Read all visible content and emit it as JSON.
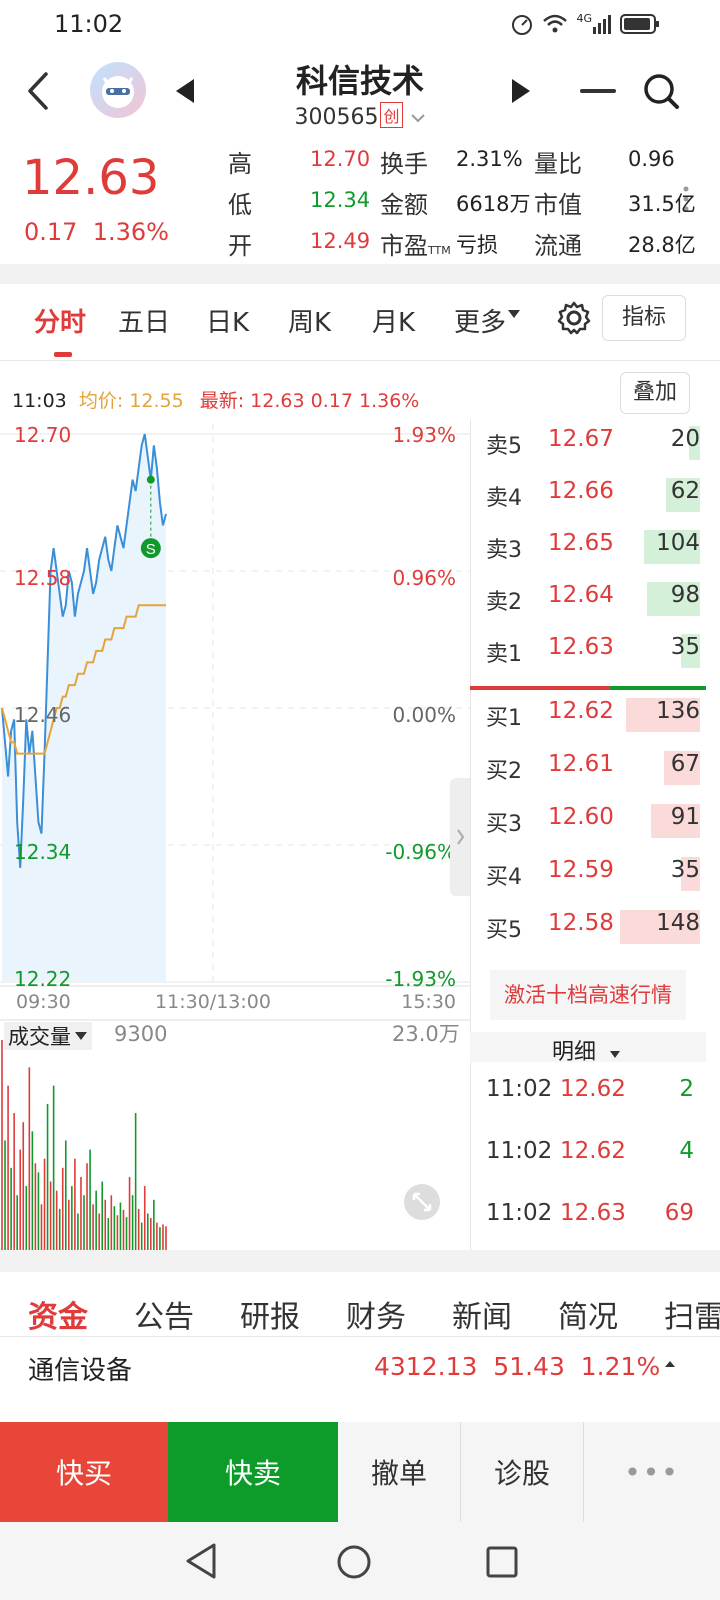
{
  "status_bar": {
    "time": "11:02",
    "network": "4G"
  },
  "header": {
    "back_icon": "chevron-left-icon",
    "title": "科信技术",
    "code": "300565",
    "board_tag": "创",
    "prev_icon": "triangle-left-icon",
    "next_icon": "triangle-right-icon",
    "menu_icon": "minus-icon",
    "search_icon": "search-icon"
  },
  "quote": {
    "price": "12.63",
    "change": "0.17",
    "change_pct": "1.36%",
    "rows": [
      [
        {
          "label": "高",
          "value": "12.70",
          "color": "#e03b3b"
        },
        {
          "label": "换手",
          "value": "2.31%",
          "color": "#222"
        },
        {
          "label": "量比",
          "value": "0.96",
          "color": "#222"
        }
      ],
      [
        {
          "label": "低",
          "value": "12.34",
          "color": "#119a2c"
        },
        {
          "label": "金额",
          "value": "6618万",
          "color": "#222"
        },
        {
          "label": "市值",
          "value": "31.5亿",
          "color": "#222"
        }
      ],
      [
        {
          "label": "开",
          "value": "12.49",
          "color": "#e03b3b"
        },
        {
          "label": "市盈TTM",
          "value": "亏损",
          "color": "#222"
        },
        {
          "label": "流通",
          "value": "28.8亿",
          "color": "#222"
        }
      ]
    ]
  },
  "tabs": {
    "items": [
      "分时",
      "五日",
      "日K",
      "周K",
      "月K",
      "更多"
    ],
    "active": "分时",
    "settings_icon": "gear-icon",
    "indicator_button": "指标"
  },
  "info_bar": {
    "time": "11:03",
    "avg_label": "均价:",
    "avg_value": "12.55",
    "latest_label": "最新:",
    "latest_value": "12.63",
    "latest_change": "0.17",
    "latest_pct": "1.36%",
    "overlay_button": "叠加"
  },
  "chart_data": {
    "type": "line",
    "title": "",
    "y_labels_left": [
      "12.70",
      "12.58",
      "12.46",
      "12.34",
      "12.22"
    ],
    "y_labels_right": [
      "1.93%",
      "0.96%",
      "0.00%",
      "-0.96%",
      "-1.93%"
    ],
    "ylim": [
      12.22,
      12.7
    ],
    "prev_close": 12.46,
    "x_labels": [
      "09:30",
      "11:30/13:00",
      "15:30"
    ],
    "series": [
      {
        "key": "price",
        "color": "#3a8fd8",
        "values": [
          12.46,
          12.43,
          12.4,
          12.44,
          12.45,
          12.36,
          12.32,
          12.38,
          12.45,
          12.42,
          12.44,
          12.4,
          12.36,
          12.35,
          12.42,
          12.5,
          12.58,
          12.6,
          12.58,
          12.56,
          12.54,
          12.55,
          12.58,
          12.57,
          12.54,
          12.56,
          12.57,
          12.58,
          12.6,
          12.58,
          12.56,
          12.57,
          12.59,
          12.6,
          12.61,
          12.59,
          12.58,
          12.6,
          12.62,
          12.61,
          12.6,
          12.62,
          12.64,
          12.66,
          12.65,
          12.67,
          12.69,
          12.7,
          12.68,
          12.66,
          12.69,
          12.67,
          12.64,
          12.62,
          12.63
        ]
      },
      {
        "key": "avg",
        "color": "#e6a23c",
        "values": [
          12.46,
          12.45,
          12.44,
          12.43,
          12.43,
          12.42,
          12.42,
          12.42,
          12.42,
          12.42,
          12.42,
          12.42,
          12.42,
          12.42,
          12.42,
          12.43,
          12.44,
          12.45,
          12.46,
          12.46,
          12.47,
          12.47,
          12.48,
          12.48,
          12.48,
          12.49,
          12.49,
          12.49,
          12.5,
          12.5,
          12.5,
          12.51,
          12.51,
          12.51,
          12.52,
          12.52,
          12.52,
          12.53,
          12.53,
          12.53,
          12.53,
          12.54,
          12.54,
          12.54,
          12.54,
          12.55,
          12.55,
          12.55,
          12.55,
          12.55,
          12.55,
          12.55,
          12.55,
          12.55,
          12.55
        ]
      }
    ],
    "markers": [
      {
        "label": "S",
        "value": 12.6
      }
    ],
    "volume": {
      "label": "成交量",
      "current": "9300",
      "max_label": "23.0万",
      "max": 230000,
      "bars": [
        230000,
        120000,
        180000,
        90000,
        150000,
        60000,
        110000,
        140000,
        70000,
        200000,
        130000,
        95000,
        85000,
        50000,
        100000,
        160000,
        75000,
        180000,
        65000,
        45000,
        90000,
        120000,
        55000,
        70000,
        100000,
        40000,
        80000,
        60000,
        95000,
        110000,
        50000,
        65000,
        40000,
        75000,
        55000,
        35000,
        60000,
        48000,
        38000,
        52000,
        44000,
        36000,
        80000,
        60000,
        150000,
        45000,
        30000,
        70000,
        40000,
        35000,
        55000,
        30000,
        25000,
        28000,
        26000
      ],
      "colors": [
        "r",
        "g",
        "r",
        "g",
        "r",
        "g",
        "r",
        "r",
        "g",
        "r",
        "g",
        "r",
        "g",
        "r",
        "r",
        "g",
        "r",
        "g",
        "r",
        "g",
        "r",
        "g",
        "r",
        "g",
        "r",
        "g",
        "r",
        "g",
        "r",
        "g",
        "r",
        "g",
        "r",
        "g",
        "r",
        "g",
        "r",
        "g",
        "r",
        "g",
        "r",
        "g",
        "r",
        "g",
        "g",
        "r",
        "g",
        "r",
        "g",
        "r",
        "g",
        "r",
        "g",
        "r",
        "r"
      ]
    }
  },
  "order_book": {
    "asks": [
      {
        "label": "卖5",
        "price": "12.67",
        "vol": "20",
        "bar": 0.14
      },
      {
        "label": "卖4",
        "price": "12.66",
        "vol": "62",
        "bar": 0.42
      },
      {
        "label": "卖3",
        "price": "12.65",
        "vol": "104",
        "bar": 0.7
      },
      {
        "label": "卖2",
        "price": "12.64",
        "vol": "98",
        "bar": 0.66
      },
      {
        "label": "卖1",
        "price": "12.63",
        "vol": "35",
        "bar": 0.24
      }
    ],
    "bids": [
      {
        "label": "买1",
        "price": "12.62",
        "vol": "136",
        "bar": 0.92
      },
      {
        "label": "买2",
        "price": "12.61",
        "vol": "67",
        "bar": 0.45
      },
      {
        "label": "买3",
        "price": "12.60",
        "vol": "91",
        "bar": 0.61
      },
      {
        "label": "买4",
        "price": "12.59",
        "vol": "35",
        "bar": 0.24
      },
      {
        "label": "买5",
        "price": "12.58",
        "vol": "148",
        "bar": 1.0
      }
    ],
    "activate_button": "激活十档高速行情"
  },
  "ticks": {
    "header": "明细",
    "rows": [
      {
        "time": "11:02",
        "price": "12.62",
        "vol": "2",
        "vol_color": "#119a2c"
      },
      {
        "time": "11:02",
        "price": "12.62",
        "vol": "4",
        "vol_color": "#119a2c"
      },
      {
        "time": "11:02",
        "price": "12.63",
        "vol": "69",
        "vol_color": "#e03b3b"
      }
    ]
  },
  "bottom_tabs": {
    "items": [
      "资金",
      "公告",
      "研报",
      "财务",
      "新闻",
      "简况",
      "扫雷"
    ],
    "active": "资金"
  },
  "sector": {
    "name": "通信设备",
    "value": "4312.13",
    "change": "51.43",
    "pct": "1.21%"
  },
  "actions": {
    "buy": "快买",
    "sell": "快卖",
    "cancel": "撤单",
    "diagnose": "诊股",
    "more": "•••"
  },
  "colors": {
    "up": "#e03b3b",
    "down": "#119a2c",
    "price_line": "#3a8fd8",
    "avg_line": "#e6a23c"
  }
}
